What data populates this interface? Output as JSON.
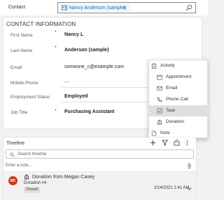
{
  "contact_bar": {
    "label": "Contact",
    "selected_record": "Nancy Anderson (sample)"
  },
  "contact_info": {
    "title": "CONTACT INFORMATION",
    "fields": [
      {
        "label": "First Name",
        "value": "Nancy L",
        "required": true
      },
      {
        "label": "Last Name",
        "value": "Anderson (sample)",
        "required": true
      },
      {
        "label": "Email",
        "value": "someone_c@example.com",
        "required": false
      },
      {
        "label": "Mobile Phone",
        "value": "---",
        "required": false
      },
      {
        "label": "Employment Status",
        "value": "Employed",
        "required": false
      },
      {
        "label": "Job Title",
        "value": "Purchasing Assistant",
        "required": true
      }
    ],
    "required_mark": "*"
  },
  "menu": {
    "items": [
      {
        "label": "Activity",
        "icon": "clipboard-icon"
      },
      {
        "label": "Appointment",
        "icon": "calendar-icon"
      },
      {
        "label": "Email",
        "icon": "mail-icon"
      },
      {
        "label": "Phone Call",
        "icon": "phone-icon"
      },
      {
        "label": "Task",
        "icon": "task-icon",
        "selected": true
      },
      {
        "label": "Donation",
        "icon": "bank-icon"
      },
      {
        "label": "Note",
        "icon": "note-icon"
      }
    ]
  },
  "timeline": {
    "title": "Timeline",
    "search_placeholder": "Search timeline",
    "note_placeholder": "Enter a note...",
    "post": {
      "avatar_initials": "MC",
      "avatar_color": "#c43e1c",
      "title": "Donation from Megan Casey",
      "subtitle": "Donation #4",
      "status": "Closed",
      "date": "2/14/2021 1:41 AM"
    }
  }
}
